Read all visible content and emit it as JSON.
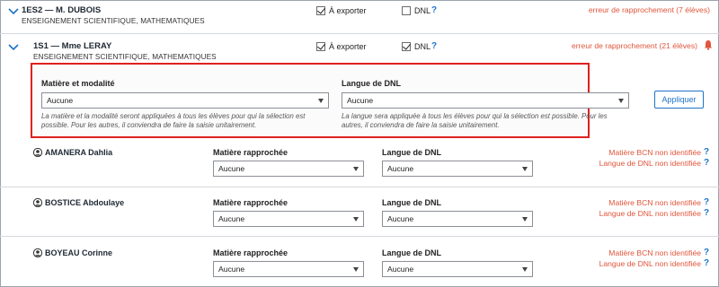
{
  "classes": [
    {
      "title": "1ES2 — M. DUBOIS",
      "subjects": "ENSEIGNEMENT SCIENTIFIQUE,  MATHEMATIQUES",
      "export_label": "À exporter",
      "export_checked": true,
      "dnl_label": "DNL",
      "dnl_checked": false,
      "help_symbol": "?",
      "error": "erreur de rapprochement (7 élèves)"
    },
    {
      "title": "1S1 — Mme LERAY",
      "subjects": "ENSEIGNEMENT SCIENTIFIQUE,  MATHEMATIQUES",
      "export_label": "À exporter",
      "export_checked": true,
      "dnl_label": "DNL",
      "dnl_checked": true,
      "help_symbol": "?",
      "error": "erreur de rapprochement (21 élèves)"
    }
  ],
  "bulk_panel": {
    "subject_label": "Matière et modalité",
    "subject_value": "Aucune",
    "subject_help": "La matière et la modalité seront appliquées à tous les élèves pour qui la sélection est possible. Pour les autres, il conviendra de faire la saisie unitairement.",
    "language_label": "Langue de DNL",
    "language_value": "Aucune",
    "language_help": "La langue sera appliquée à tous les élèves pour qui la sélection est possible. Pour les autres, il conviendra de faire la saisie unitairement.",
    "apply_label": "Appliquer"
  },
  "students": [
    {
      "name": "AMANERA Dahlia",
      "subject_label": "Matière rapprochée",
      "subject_value": "Aucune",
      "language_label": "Langue de DNL",
      "language_value": "Aucune",
      "error_subject": "Matière BCN non identifiée",
      "error_language": "Langue de DNL non identifiée",
      "help_symbol": "?"
    },
    {
      "name": "BOSTICE Abdoulaye",
      "subject_label": "Matière rapprochée",
      "subject_value": "Aucune",
      "language_label": "Langue de DNL",
      "language_value": "Aucune",
      "error_subject": "Matière BCN non identifiée",
      "error_language": "Langue de DNL non identifiée",
      "help_symbol": "?"
    },
    {
      "name": "BOYEAU Corinne",
      "subject_label": "Matière rapprochée",
      "subject_value": "Aucune",
      "language_label": "Langue de DNL",
      "language_value": "Aucune",
      "error_subject": "Matière BCN non identifiée",
      "error_language": "Langue de DNL non identifiée",
      "help_symbol": "?"
    }
  ],
  "colors": {
    "accent": "#1e73c8",
    "error": "#e0553b",
    "highlight_border": "#e02020",
    "bell": "#e0553b"
  },
  "icons": {
    "expand": "chevron-down-icon",
    "alert": "bell-icon",
    "student": "user-icon",
    "help": "question-mark-icon"
  }
}
